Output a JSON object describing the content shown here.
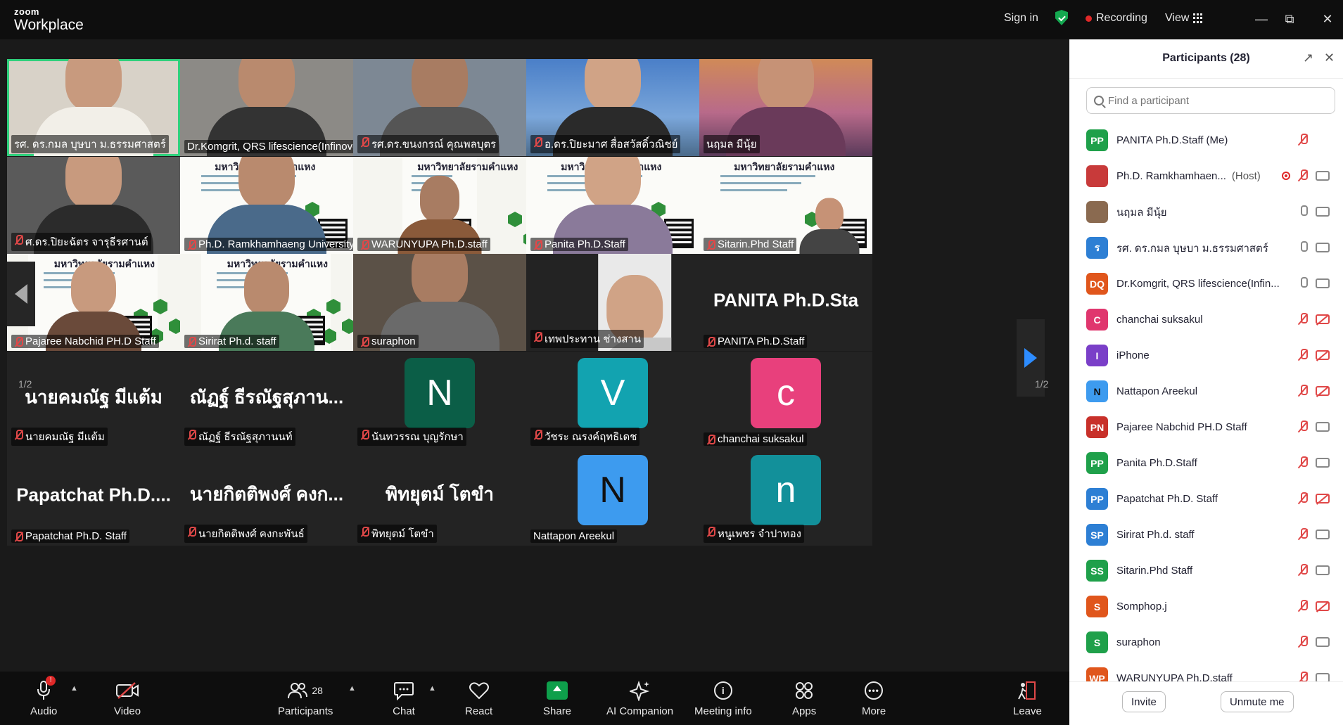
{
  "app": {
    "logo_top": "zoom",
    "logo_bottom": "Workplace",
    "sign_in": "Sign in",
    "recording": "Recording",
    "view": "View"
  },
  "grid": {
    "page_left": "1/2",
    "page_right": "1/2",
    "tiles": [
      {
        "name": "รศ. ดร.กมล บุษบา ม.ธรรมศาสตร์",
        "muted": false
      },
      {
        "name": "Dr.Komgrit, QRS lifescience(Infinovo)",
        "muted": false
      },
      {
        "name": "รศ.ดร.ขนงกรณ์ คุณพลบุตร",
        "muted": true
      },
      {
        "name": "อ.ดร.ปิยะมาศ สื่อสวัสดิ์วณิชย์",
        "muted": true
      },
      {
        "name": "นฤมล มีนุ้ย",
        "muted": false
      },
      {
        "name": "ศ.ดร.ปิยะฉัตร จารุธีรศานต์",
        "muted": true
      },
      {
        "name": "Ph.D. Ramkhamhaeng University",
        "muted": true
      },
      {
        "name": "WARUNYUPA Ph.D.staff",
        "muted": true
      },
      {
        "name": "Panita Ph.D.Staff",
        "muted": true
      },
      {
        "name": "Sitarin.Phd Staff",
        "muted": true
      },
      {
        "name": "Pajaree Nabchid PH.D Staff",
        "muted": true
      },
      {
        "name": "Sirirat Ph.d. staff",
        "muted": true
      },
      {
        "name": "suraphon",
        "muted": true
      },
      {
        "name": "เทพประทาน ช่างสาน",
        "muted": true
      },
      {
        "name": "PANITA Ph.D.Staff",
        "muted": true,
        "big": "PANITA Ph.D.Sta"
      },
      {
        "name": "นายคมณัฐ มีแต้ม",
        "muted": true,
        "big": "นายคมณัฐ มีแต้ม"
      },
      {
        "name": "ณัฏฐ์ ธีรณัฐสุภานนท์",
        "muted": true,
        "big": "ณัฏฐ์ ธีรณัฐสุภาน..."
      },
      {
        "name": "นันทวรรณ บุญรักษา",
        "muted": true,
        "avatar": "N",
        "color": "#0b5e47"
      },
      {
        "name": "วัชระ ณรงค์ฤทธิเดช",
        "muted": true,
        "avatar": "V",
        "color": "#12a3b0"
      },
      {
        "name": "chanchai suksakul",
        "muted": true,
        "avatar": "c",
        "color": "#e8407c"
      },
      {
        "name": "Papatchat Ph.D. Staff",
        "muted": true,
        "big": "Papatchat  Ph.D...."
      },
      {
        "name": "นายกิตติพงศ์ คงกะพันธ์",
        "muted": true,
        "big": "นายกิตติพงศ์ คงก..."
      },
      {
        "name": "พิทยุตม์ โตขำ",
        "muted": true,
        "big": "พิทยุตม์ โตขำ"
      },
      {
        "name": "Nattapon Areekul",
        "muted": false,
        "avatar": "N",
        "color": "#3d9bef",
        "avatar_text_color": "#111"
      },
      {
        "name": "หนูเพชร จำปาทอง",
        "muted": true,
        "avatar": "n",
        "color": "#12909a"
      }
    ],
    "poster_title": "มหาวิทยาลัยรามคำแหง",
    "poster_logo": "PhD"
  },
  "toolbar": {
    "audio": "Audio",
    "audio_badge": "!",
    "video": "Video",
    "participants": "Participants",
    "participants_count": "28",
    "chat": "Chat",
    "react": "React",
    "share": "Share",
    "ai_companion": "AI Companion",
    "meeting_info": "Meeting info",
    "apps": "Apps",
    "more": "More",
    "leave": "Leave"
  },
  "panel": {
    "title": "Participants (28)",
    "search_placeholder": "Find a participant",
    "participants": [
      {
        "initials": "PP",
        "color": "#1fa04a",
        "name": "PANITA Ph.D.Staff (Me)",
        "role": "",
        "mic": "muted",
        "cam": "none"
      },
      {
        "initials": "",
        "color": "#c83a3a",
        "name": "Ph.D. Ramkhamhaen...",
        "role": "(Host)",
        "mic": "muted",
        "cam": "on",
        "rec": true
      },
      {
        "initials": "",
        "color": "#8a6a50",
        "name": "นฤมล มีนุ้ย",
        "role": "",
        "mic": "on",
        "cam": "on"
      },
      {
        "initials": "ร",
        "color": "#2d7fd4",
        "name": "รศ. ดร.กมล บุษบา ม.ธรรมศาสตร์",
        "role": "",
        "mic": "on",
        "cam": "on"
      },
      {
        "initials": "DQ",
        "color": "#e0561c",
        "name": "Dr.Komgrit, QRS lifescience(Infin...",
        "role": "",
        "mic": "on",
        "cam": "on"
      },
      {
        "initials": "C",
        "color": "#e0366e",
        "name": "chanchai suksakul",
        "role": "",
        "mic": "muted",
        "cam": "off"
      },
      {
        "initials": "I",
        "color": "#7a3fc8",
        "name": "iPhone",
        "role": "",
        "mic": "muted",
        "cam": "off"
      },
      {
        "initials": "N",
        "color": "#3d9bef",
        "name": "Nattapon Areekul",
        "role": "",
        "mic": "muted",
        "cam": "off",
        "text_color": "#111"
      },
      {
        "initials": "PN",
        "color": "#c8302a",
        "name": "Pajaree Nabchid PH.D Staff",
        "role": "",
        "mic": "muted",
        "cam": "on"
      },
      {
        "initials": "PP",
        "color": "#1fa04a",
        "name": "Panita Ph.D.Staff",
        "role": "",
        "mic": "muted",
        "cam": "on"
      },
      {
        "initials": "PP",
        "color": "#2d7fd4",
        "name": "Papatchat Ph.D. Staff",
        "role": "",
        "mic": "muted",
        "cam": "off"
      },
      {
        "initials": "SP",
        "color": "#2d7fd4",
        "name": "Sirirat Ph.d. staff",
        "role": "",
        "mic": "muted",
        "cam": "on"
      },
      {
        "initials": "SS",
        "color": "#1fa04a",
        "name": "Sitarin.Phd Staff",
        "role": "",
        "mic": "muted",
        "cam": "on"
      },
      {
        "initials": "S",
        "color": "#e0561c",
        "name": "Somphop.j",
        "role": "",
        "mic": "muted",
        "cam": "off"
      },
      {
        "initials": "S",
        "color": "#1fa04a",
        "name": "suraphon",
        "role": "",
        "mic": "muted",
        "cam": "on"
      },
      {
        "initials": "WP",
        "color": "#e0561c",
        "name": "WARUNYUPA Ph.D.staff",
        "role": "",
        "mic": "muted",
        "cam": "on"
      }
    ],
    "invite": "Invite",
    "unmute": "Unmute me"
  }
}
